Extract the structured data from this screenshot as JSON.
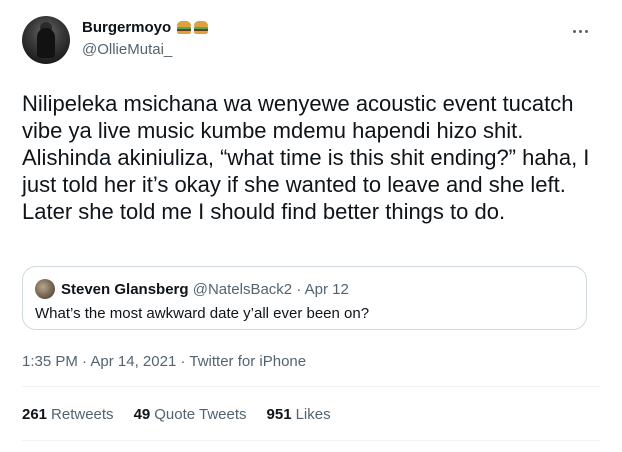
{
  "author": {
    "display_name": "Burgermoyo",
    "emoji": [
      "burger-emoji",
      "burger-emoji"
    ],
    "handle": "@OllieMutai_"
  },
  "tweet": {
    "text": "Nilipeleka msichana wa wenyewe acoustic event tucatch vibe ya live music kumbe mdemu hapendi hizo shit. Alishinda akiniuliza, “what time is this shit ending?” haha, I just told her it’s okay if she wanted to leave and she left.\nLater she told me I should find better things to do."
  },
  "quote": {
    "name": "Steven Glansberg",
    "handle": "@NatelsBack2",
    "separator": "·",
    "date": "Apr 12",
    "text": "What’s the most awkward date y’all ever been on?"
  },
  "meta": {
    "time": "1:35 PM",
    "separator": "·",
    "date": "Apr 14, 2021",
    "source": "Twitter for iPhone"
  },
  "stats": {
    "retweets_count": "261",
    "retweets_label": "Retweets",
    "quotes_count": "49",
    "quotes_label": "Quote Tweets",
    "likes_count": "951",
    "likes_label": "Likes"
  },
  "colors": {
    "text_primary": "#0f1419",
    "text_secondary": "#536471",
    "border": "#cfd9de"
  }
}
